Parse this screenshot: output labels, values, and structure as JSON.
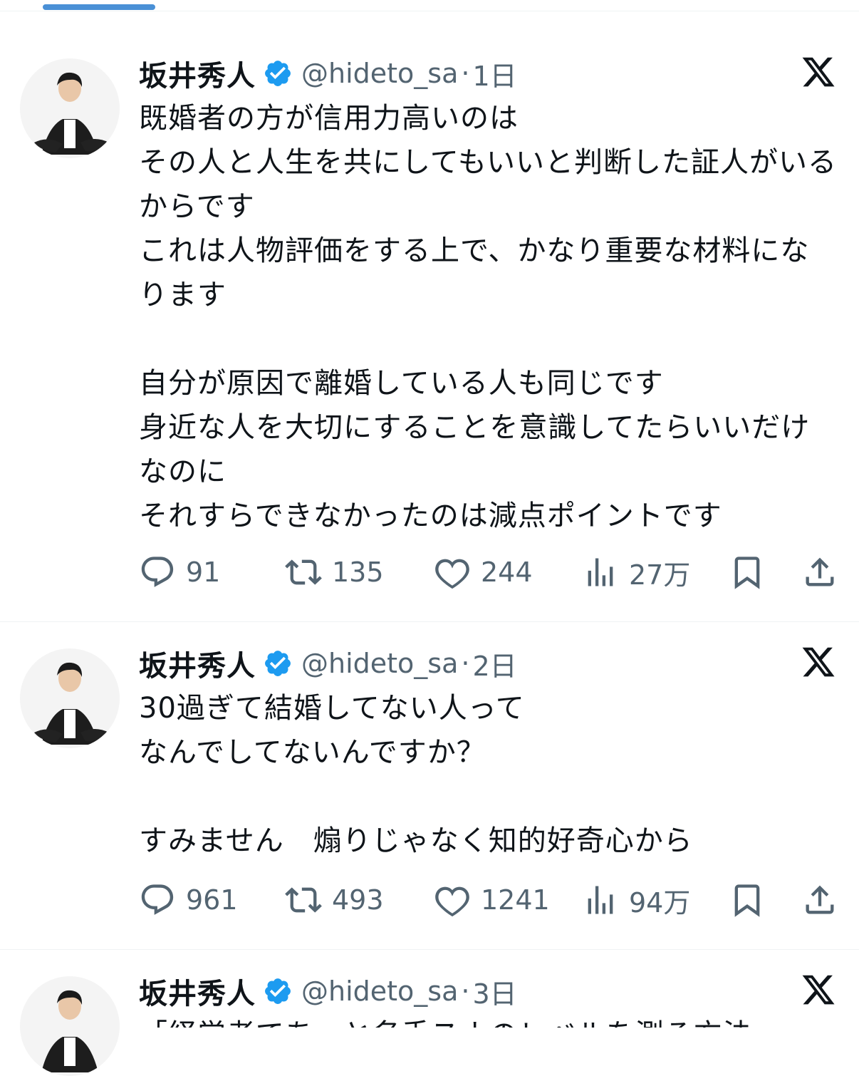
{
  "tweets": [
    {
      "name": "坂井秀人",
      "handle": "@hideto_sa",
      "separator": "·",
      "time": "1日",
      "text": "既婚者の方が信用力高いのは\nその人と人生を共にしてもいいと判断した証人がいるからです\nこれは人物評価をする上で、かなり重要な材料になります\n\n自分が原因で離婚している人も同じです\n身近な人を大切にすることを意識してたらいいだけなのに\nそれすらできなかったのは減点ポイントです",
      "replies": "91",
      "reposts": "135",
      "likes": "244",
      "views": "27万"
    },
    {
      "name": "坂井秀人",
      "handle": "@hideto_sa",
      "separator": "·",
      "time": "2日",
      "text": "30過ぎて結婚してない人って\nなんでしてないんですか？\n\nすみません　煽りじゃなく知的好奇心から",
      "replies": "961",
      "reposts": "493",
      "likes": "1241",
      "views": "94万"
    },
    {
      "name": "坂井秀人",
      "handle": "@hideto_sa",
      "separator": "·",
      "time": "3日",
      "text": "「経営者であっと名手スナのレベルを測る方法"
    }
  ],
  "icons": {
    "verified": "verified-badge-icon",
    "x_logo": "x-logo-icon",
    "reply": "reply-icon",
    "repost": "repost-icon",
    "like": "heart-icon",
    "views": "views-icon",
    "bookmark": "bookmark-icon",
    "share": "share-icon"
  },
  "colors": {
    "verified": "#1d9bf0",
    "secondary_text": "#536471",
    "tab_indicator": "#4a90d6"
  }
}
